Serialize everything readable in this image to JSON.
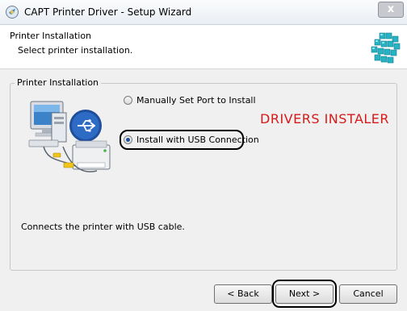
{
  "window": {
    "title": "CAPT Printer Driver - Setup Wizard",
    "close_glyph": "x"
  },
  "header": {
    "title": "Printer Installation",
    "subtitle": "Select printer installation."
  },
  "group": {
    "label": "Printer Installation",
    "options": [
      {
        "label": "Manually Set Port to Install",
        "selected": false
      },
      {
        "label": "Install with USB Connection",
        "selected": true
      }
    ],
    "description": "Connects the printer with USB cable."
  },
  "watermark": "DRIVERS INSTALER",
  "buttons": {
    "back": "< Back",
    "next": "Next >",
    "cancel": "Cancel"
  },
  "icons": {
    "app": "setup-wizard-icon",
    "header": "install-cubes-icon",
    "illustration": "computer-usb-printer-icon"
  },
  "colors": {
    "watermark": "#d61a1a",
    "header_accent": "#1aa7b8"
  }
}
